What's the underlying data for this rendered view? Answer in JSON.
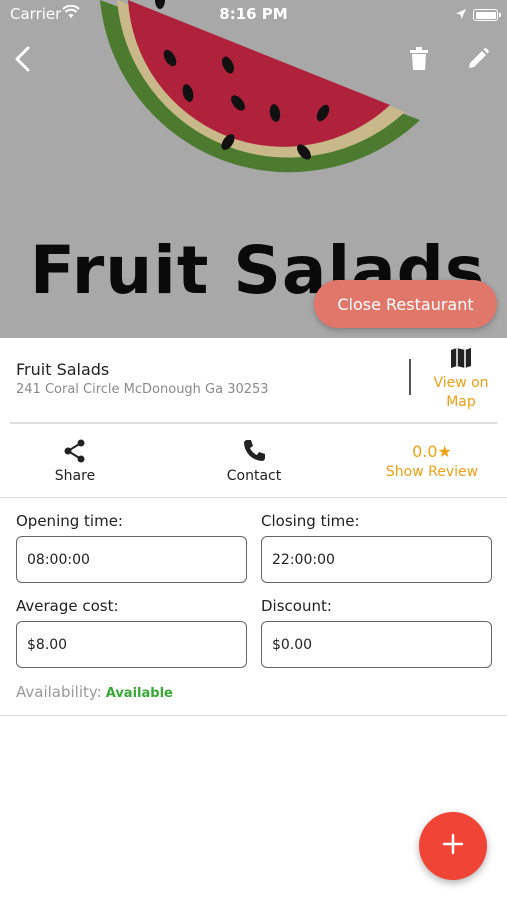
{
  "status_bar": {
    "carrier": "Carrier",
    "time": "8:16 PM"
  },
  "hero": {
    "title": "Fruit Salads",
    "close_button_label": "Close Restaurant"
  },
  "nav": {
    "back_icon": "back-arrow-icon",
    "delete_icon": "trash-icon",
    "edit_icon": "pencil-icon"
  },
  "restaurant": {
    "name": "Fruit Salads",
    "address": "241 Coral Circle McDonough Ga 30253",
    "map_label_line1": "View on",
    "map_label_line2": "Map"
  },
  "actions": {
    "share_label": "Share",
    "contact_label": "Contact",
    "review_score": "0.0",
    "review_label": "Show Review"
  },
  "fields": {
    "opening_time": {
      "label": "Opening time:",
      "value": "08:00:00"
    },
    "closing_time": {
      "label": "Closing time:",
      "value": "22:00:00"
    },
    "average_cost": {
      "label": "Average cost:",
      "value": "$8.00"
    },
    "discount": {
      "label": "Discount:",
      "value": "$0.00"
    }
  },
  "availability": {
    "label": "Availability:",
    "value": "Available"
  },
  "colors": {
    "accent": "#f0a012",
    "close_button": "#e0776a",
    "fab": "#f04437",
    "available": "#39a935"
  }
}
